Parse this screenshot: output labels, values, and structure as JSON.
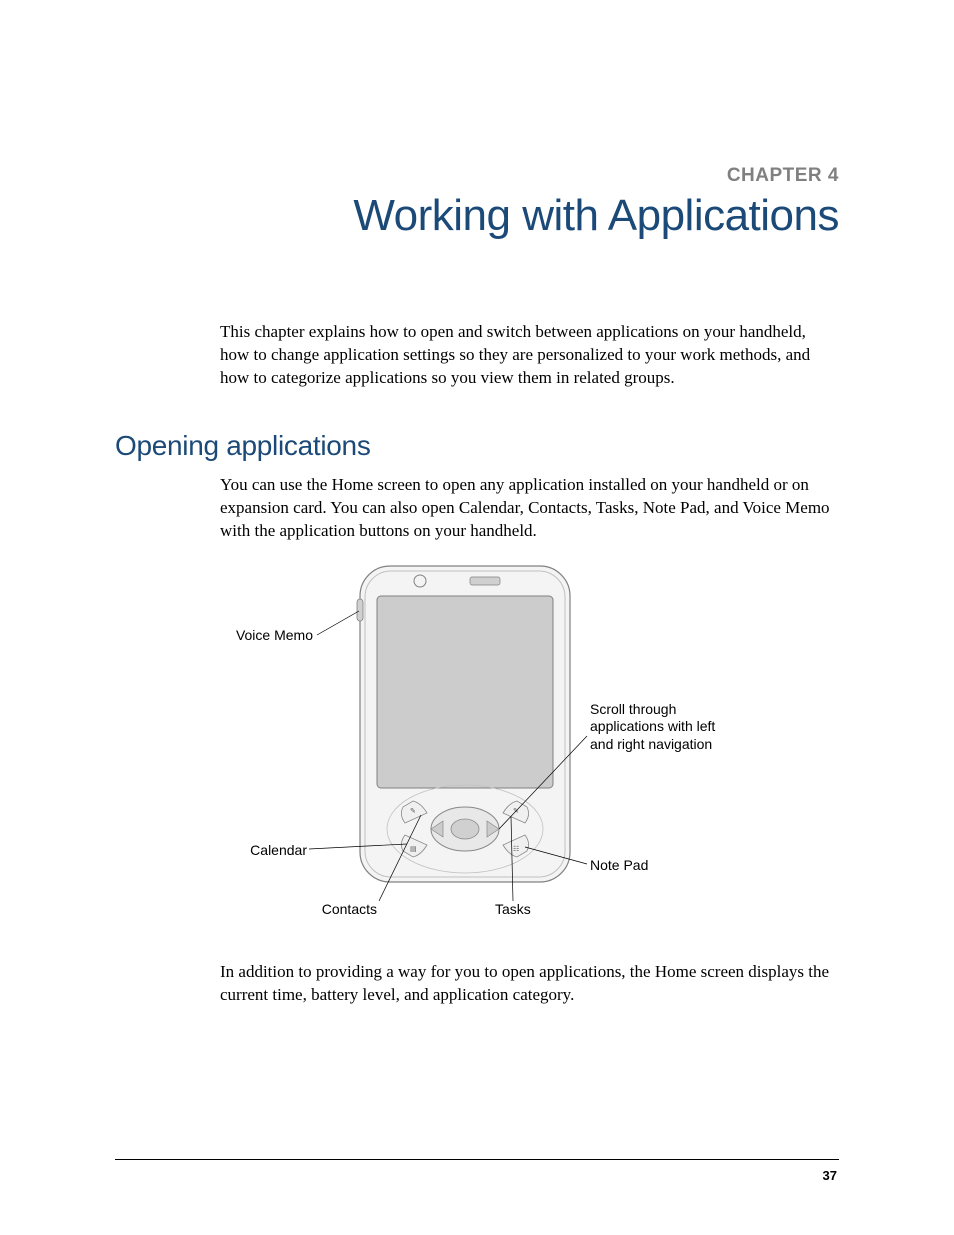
{
  "chapter": {
    "label": "CHAPTER 4",
    "title": "Working with Applications"
  },
  "intro_paragraph": "This chapter explains how to open and switch between applications on your handheld, how to change application settings so they are personalized to your work methods, and how to categorize applications so you view them in related groups.",
  "section": {
    "heading": "Opening applications",
    "para1": "You can use the Home screen to open any application installed on your handheld or on expansion card. You can also open Calendar, Contacts, Tasks, Note Pad, and Voice Memo with the application buttons on your handheld.",
    "para2": "In addition to providing a way for you to open applications, the Home screen displays the current time, battery level, and application category."
  },
  "figure": {
    "callouts": {
      "voice_memo": "Voice Memo",
      "scroll": "Scroll through applications with left and right navigation",
      "calendar": "Calendar",
      "note_pad": "Note Pad",
      "contacts": "Contacts",
      "tasks": "Tasks"
    }
  },
  "page_number": "37"
}
